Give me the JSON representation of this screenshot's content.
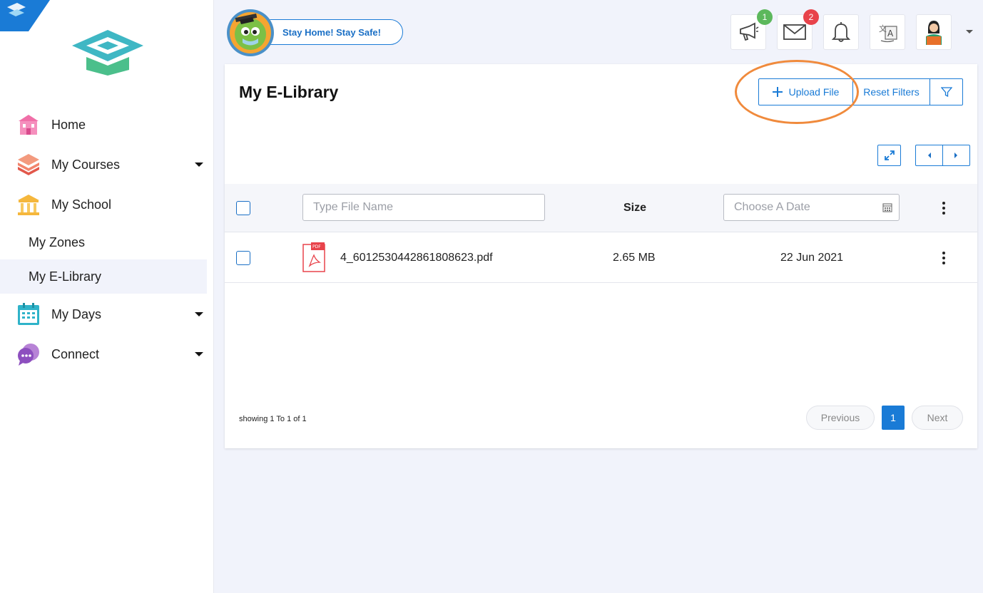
{
  "sidebar": {
    "items": [
      {
        "label": "Home",
        "icon": "home-icon",
        "has_caret": false
      },
      {
        "label": "My Courses",
        "icon": "books-icon",
        "has_caret": true
      },
      {
        "label": "My School",
        "icon": "school-building-icon",
        "has_caret": false
      },
      {
        "label": "My Days",
        "icon": "calendar-icon",
        "has_caret": true
      },
      {
        "label": "Connect",
        "icon": "chat-bubbles-icon",
        "has_caret": true
      }
    ],
    "sub_items": [
      {
        "label": "My Zones",
        "active": false
      },
      {
        "label": "My E-Library",
        "active": true
      }
    ]
  },
  "topbar": {
    "banner_text": "Stay Home! Stay Safe!",
    "announcements_count": "1",
    "messages_count": "2"
  },
  "main": {
    "title": "My E-Library",
    "upload_label": "Upload File",
    "reset_filters_label": "Reset Filters",
    "table": {
      "name_placeholder": "Type File Name",
      "size_header": "Size",
      "date_placeholder": "Choose A Date",
      "rows": [
        {
          "file_type": "PDF",
          "name": "4_6012530442861808623.pdf",
          "size": "2.65 MB",
          "date": "22 Jun 2021"
        }
      ]
    },
    "pagination": {
      "showing_text": "showing 1 To 1 of 1",
      "previous_label": "Previous",
      "current_page": "1",
      "next_label": "Next"
    }
  },
  "colors": {
    "accent": "#1a7bd6",
    "highlight_annotation": "#f08a3c",
    "pdf_icon": "#e8434b"
  }
}
